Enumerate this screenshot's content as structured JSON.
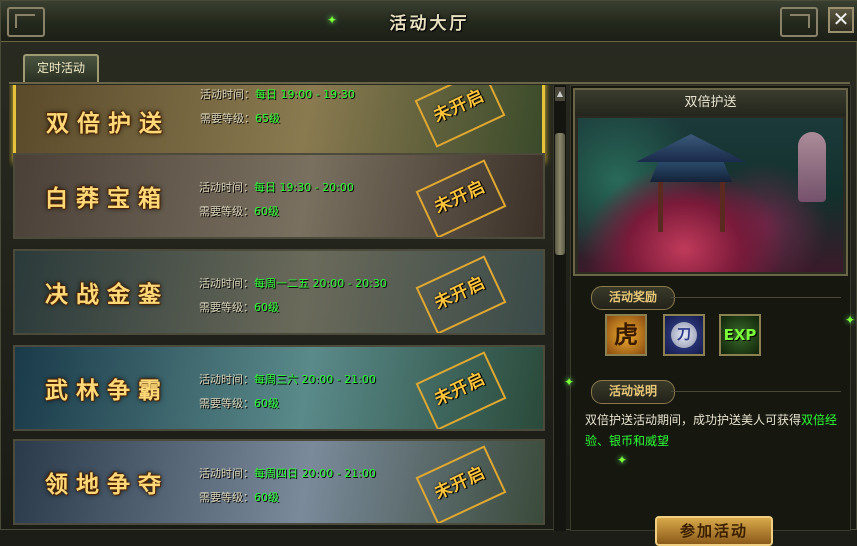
{
  "window": {
    "title": "活动大厅"
  },
  "tabs": [
    {
      "label": "定时活动"
    }
  ],
  "activities": [
    {
      "name": "双倍护送",
      "time_label": "活动时间：",
      "time_value": "每日 19:00 - 19:30",
      "level_label": "需要等级：",
      "level_value": "65级",
      "status": "未开启",
      "bg": [
        "#5a4a2a",
        "#8a7a50",
        "#3a4a2a"
      ]
    },
    {
      "name": "白莽宝箱",
      "time_label": "活动时间：",
      "time_value": "每日 19:30 - 20:00",
      "level_label": "需要等级：",
      "level_value": "60级",
      "status": "未开启",
      "bg": [
        "#4a4038",
        "#7a7060",
        "#3a3028"
      ]
    },
    {
      "name": "决战金銮",
      "time_label": "活动时间：",
      "time_value": "每周一二五 20:00 - 20:30",
      "level_label": "需要等级：",
      "level_value": "60级",
      "status": "未开启",
      "bg": [
        "#2a3a3a",
        "#6a6a5a",
        "#3a4a48"
      ]
    },
    {
      "name": "武林争霸",
      "time_label": "活动时间：",
      "time_value": "每周三六 20:00 - 21:00",
      "level_label": "需要等级：",
      "level_value": "60级",
      "status": "未开启",
      "bg": [
        "#1a3a4a",
        "#5a8a8a",
        "#2a4a3a"
      ]
    },
    {
      "name": "领地争夺",
      "time_label": "活动时间：",
      "time_value": "每周四日 20:00 - 21:00",
      "level_label": "需要等级：",
      "level_value": "60级",
      "status": "未开启",
      "bg": [
        "#2a3a4a",
        "#7a8a9a",
        "#3a4a3a"
      ]
    }
  ],
  "detail": {
    "title": "双倍护送",
    "rewards_label": "活动奖励",
    "rewards": [
      {
        "icon": "tiger-emblem-icon",
        "glyph": "虎"
      },
      {
        "icon": "blade-coin-icon",
        "glyph": "刀"
      },
      {
        "icon": "exp-icon",
        "glyph": "EXP"
      }
    ],
    "desc_label": "活动说明",
    "desc_text": "双倍护送活动期间，成功护送美人可获得",
    "desc_highlight": "双倍经验、银币和威望",
    "join_label": "参加活动"
  },
  "colors": {
    "accent_gold": "#e6c23a",
    "value_green": "#2bff36",
    "stamp_orange": "#ffc43a"
  }
}
